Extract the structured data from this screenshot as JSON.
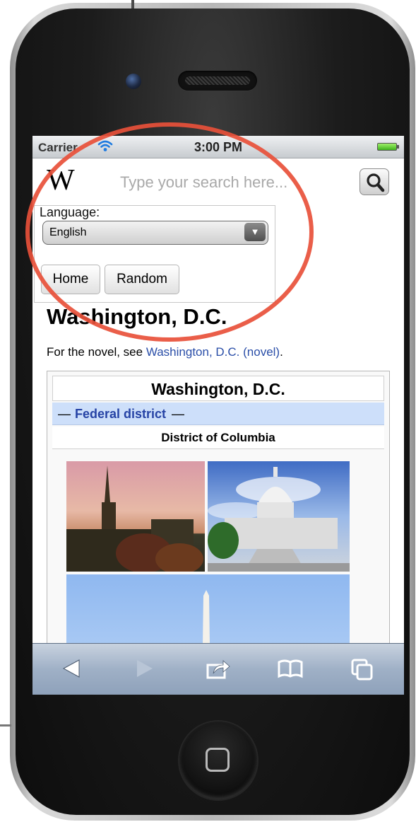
{
  "status_bar": {
    "carrier": "Carrier",
    "time": "3:00 PM"
  },
  "header": {
    "logo": "W",
    "search_placeholder": "Type your search here..."
  },
  "language": {
    "label": "Language:",
    "selected": "English"
  },
  "nav": {
    "home_label": "Home",
    "random_label": "Random"
  },
  "article": {
    "title": "Washington, D.C.",
    "hatnote_prefix": "For the novel, see ",
    "hatnote_link": "Washington, D.C. (novel)",
    "hatnote_suffix": "."
  },
  "infobox": {
    "title": "Washington, D.C.",
    "type_dash_left": "—",
    "type_link": "Federal district",
    "type_dash_right": "—",
    "subtitle": "District of Columbia"
  },
  "toolbar": {
    "icons": [
      "back-icon",
      "forward-icon",
      "share-icon",
      "bookmarks-icon",
      "tabs-icon"
    ]
  },
  "colors": {
    "link": "#2a4ea8",
    "infobox_band": "#cddffa",
    "annotation_circle": "#e8503a"
  }
}
